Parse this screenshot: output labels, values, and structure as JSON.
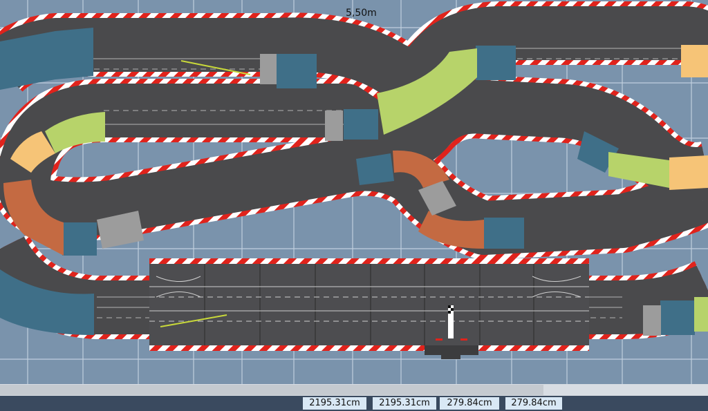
{
  "canvas": {
    "scale_label": "5,50m",
    "colors": {
      "background": "#7a93ac",
      "grid": "#c9d6e4",
      "asphalt": "#4a4a4c",
      "curb_red": "#e0231c",
      "curb_white": "#ffffff",
      "blue_section": "#3f6f88",
      "green_section": "#b7d36a",
      "orange_section": "#f6c477",
      "rust_section": "#c46a42",
      "grey_block": "#9c9c9c"
    },
    "start_finish_flag_icon": "checkered-flag-icon"
  },
  "statusbar": {
    "values": [
      "2195.31cm",
      "2195.31cm",
      "279.84cm",
      "279.84cm"
    ]
  }
}
